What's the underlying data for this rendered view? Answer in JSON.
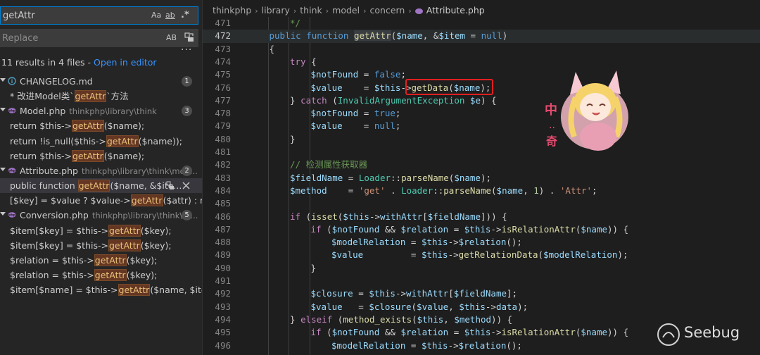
{
  "search": {
    "query": "getAttr",
    "replace_placeholder": "Replace",
    "opt_case": "Aa",
    "opt_word": "ab",
    "opt_regex": ".*",
    "opt_preserve_case": "AB",
    "more": "···",
    "summary": "11 results in 4 files - ",
    "open_in_editor": "Open in editor"
  },
  "results": [
    {
      "kind": "file",
      "name": "CHANGELOG.md",
      "path": "",
      "count": "1",
      "icon": "info-icon"
    },
    {
      "kind": "match",
      "pre": "* 改进Model类`",
      "hit": "getAttr",
      "post": "`方法"
    },
    {
      "kind": "file",
      "name": "Model.php",
      "path": "thinkphp\\library\\think",
      "count": "3",
      "icon": "php-icon"
    },
    {
      "kind": "match",
      "pre": "return $this->",
      "hit": "getAttr",
      "post": "($name);"
    },
    {
      "kind": "match",
      "pre": "return !is_null($this->",
      "hit": "getAttr",
      "post": "($name));"
    },
    {
      "kind": "match",
      "pre": "return $this->",
      "hit": "getAttr",
      "post": "($name);"
    },
    {
      "kind": "file",
      "name": "Attribute.php",
      "path": "thinkphp\\library\\think\\mod...",
      "count": "2",
      "icon": "php-icon"
    },
    {
      "kind": "match",
      "pre": "public function ",
      "hit": "getAttr",
      "post": "($name, &$ite...",
      "selected": true
    },
    {
      "kind": "match",
      "pre": "[$key] = $value ? $value->",
      "hit": "getAttr",
      "post": "($attr) : null;"
    },
    {
      "kind": "file",
      "name": "Conversion.php",
      "path": "thinkphp\\library\\think\\m...",
      "count": "5",
      "icon": "php-icon"
    },
    {
      "kind": "match",
      "pre": "$item[$key] = $this->",
      "hit": "getAttr",
      "post": "($key);"
    },
    {
      "kind": "match",
      "pre": "$item[$key] = $this->",
      "hit": "getAttr",
      "post": "($key);"
    },
    {
      "kind": "match",
      "pre": "$relation = $this->",
      "hit": "getAttr",
      "post": "($key);"
    },
    {
      "kind": "match",
      "pre": "$relation = $this->",
      "hit": "getAttr",
      "post": "($key);"
    },
    {
      "kind": "match",
      "pre": "$item[$name] = $this->",
      "hit": "getAttr",
      "post": "($name, $item);"
    }
  ],
  "breadcrumb": [
    "thinkphp",
    "library",
    "think",
    "model",
    "concern",
    "Attribute.php"
  ],
  "code_lines": [
    {
      "n": "471",
      "indent": 2,
      "toks": [
        [
          "cmt",
          "*/"
        ]
      ]
    },
    {
      "n": "472",
      "indent": 1,
      "current": true,
      "toks": [
        [
          "kw",
          "public"
        ],
        [
          "pun",
          " "
        ],
        [
          "kw",
          "function"
        ],
        [
          "pun",
          " "
        ],
        [
          "fnhl",
          "getAttr"
        ],
        [
          "pun",
          "("
        ],
        [
          "var",
          "$name"
        ],
        [
          "pun",
          ", &"
        ],
        [
          "var",
          "$item"
        ],
        [
          "pun",
          " = "
        ],
        [
          "kw",
          "null"
        ],
        [
          "pun",
          ")"
        ]
      ]
    },
    {
      "n": "473",
      "indent": 1,
      "toks": [
        [
          "pun",
          "{"
        ]
      ]
    },
    {
      "n": "474",
      "indent": 2,
      "toks": [
        [
          "ctl",
          "try"
        ],
        [
          "pun",
          " {"
        ]
      ]
    },
    {
      "n": "475",
      "indent": 3,
      "toks": [
        [
          "var",
          "$notFound"
        ],
        [
          "pun",
          " = "
        ],
        [
          "kw",
          "false"
        ],
        [
          "pun",
          ";"
        ]
      ]
    },
    {
      "n": "476",
      "indent": 3,
      "toks": [
        [
          "var",
          "$value"
        ],
        [
          "pun",
          "    = "
        ],
        [
          "var",
          "$this"
        ],
        [
          "pun",
          "->"
        ],
        [
          "fn",
          "getData"
        ],
        [
          "pun",
          "("
        ],
        [
          "var",
          "$name"
        ],
        [
          "pun",
          ");"
        ]
      ]
    },
    {
      "n": "477",
      "indent": 2,
      "toks": [
        [
          "pun",
          "} "
        ],
        [
          "ctl",
          "catch"
        ],
        [
          "pun",
          " ("
        ],
        [
          "cls",
          "InvalidArgumentException"
        ],
        [
          "pun",
          " "
        ],
        [
          "var",
          "$e"
        ],
        [
          "pun",
          ") {"
        ]
      ]
    },
    {
      "n": "478",
      "indent": 3,
      "toks": [
        [
          "var",
          "$notFound"
        ],
        [
          "pun",
          " = "
        ],
        [
          "kw",
          "true"
        ],
        [
          "pun",
          ";"
        ]
      ]
    },
    {
      "n": "479",
      "indent": 3,
      "toks": [
        [
          "var",
          "$value"
        ],
        [
          "pun",
          "    = "
        ],
        [
          "kw",
          "null"
        ],
        [
          "pun",
          ";"
        ]
      ]
    },
    {
      "n": "480",
      "indent": 2,
      "toks": [
        [
          "pun",
          "}"
        ]
      ]
    },
    {
      "n": "481",
      "indent": 0,
      "toks": []
    },
    {
      "n": "482",
      "indent": 2,
      "toks": [
        [
          "cmt",
          "// 检测属性获取器"
        ]
      ]
    },
    {
      "n": "483",
      "indent": 2,
      "toks": [
        [
          "var",
          "$fieldName"
        ],
        [
          "pun",
          " = "
        ],
        [
          "cls",
          "Loader"
        ],
        [
          "pun",
          "::"
        ],
        [
          "fn",
          "parseName"
        ],
        [
          "pun",
          "("
        ],
        [
          "var",
          "$name"
        ],
        [
          "pun",
          ");"
        ]
      ]
    },
    {
      "n": "484",
      "indent": 2,
      "toks": [
        [
          "var",
          "$method"
        ],
        [
          "pun",
          "    = "
        ],
        [
          "str",
          "'get'"
        ],
        [
          "pun",
          " . "
        ],
        [
          "cls",
          "Loader"
        ],
        [
          "pun",
          "::"
        ],
        [
          "fn",
          "parseName"
        ],
        [
          "pun",
          "("
        ],
        [
          "var",
          "$name"
        ],
        [
          "pun",
          ", "
        ],
        [
          "num",
          "1"
        ],
        [
          "pun",
          ") . "
        ],
        [
          "str",
          "'Attr'"
        ],
        [
          "pun",
          ";"
        ]
      ]
    },
    {
      "n": "485",
      "indent": 0,
      "toks": []
    },
    {
      "n": "486",
      "indent": 2,
      "toks": [
        [
          "ctl",
          "if"
        ],
        [
          "pun",
          " ("
        ],
        [
          "fn",
          "isset"
        ],
        [
          "pun",
          "("
        ],
        [
          "var",
          "$this"
        ],
        [
          "pun",
          "->"
        ],
        [
          "var",
          "withAttr"
        ],
        [
          "pun",
          "["
        ],
        [
          "var",
          "$fieldName"
        ],
        [
          "pun",
          "])) {"
        ]
      ]
    },
    {
      "n": "487",
      "indent": 3,
      "toks": [
        [
          "ctl",
          "if"
        ],
        [
          "pun",
          " ("
        ],
        [
          "var",
          "$notFound"
        ],
        [
          "pun",
          " && "
        ],
        [
          "var",
          "$relation"
        ],
        [
          "pun",
          " = "
        ],
        [
          "var",
          "$this"
        ],
        [
          "pun",
          "->"
        ],
        [
          "fn",
          "isRelationAttr"
        ],
        [
          "pun",
          "("
        ],
        [
          "var",
          "$name"
        ],
        [
          "pun",
          ")) {"
        ]
      ]
    },
    {
      "n": "488",
      "indent": 4,
      "toks": [
        [
          "var",
          "$modelRelation"
        ],
        [
          "pun",
          " = "
        ],
        [
          "var",
          "$this"
        ],
        [
          "pun",
          "->"
        ],
        [
          "var",
          "$relation"
        ],
        [
          "pun",
          "();"
        ]
      ]
    },
    {
      "n": "489",
      "indent": 4,
      "toks": [
        [
          "var",
          "$value"
        ],
        [
          "pun",
          "         = "
        ],
        [
          "var",
          "$this"
        ],
        [
          "pun",
          "->"
        ],
        [
          "fn",
          "getRelationData"
        ],
        [
          "pun",
          "("
        ],
        [
          "var",
          "$modelRelation"
        ],
        [
          "pun",
          ");"
        ]
      ]
    },
    {
      "n": "490",
      "indent": 3,
      "toks": [
        [
          "pun",
          "}"
        ]
      ]
    },
    {
      "n": "491",
      "indent": 0,
      "toks": []
    },
    {
      "n": "492",
      "indent": 3,
      "toks": [
        [
          "var",
          "$closure"
        ],
        [
          "pun",
          " = "
        ],
        [
          "var",
          "$this"
        ],
        [
          "pun",
          "->"
        ],
        [
          "var",
          "withAttr"
        ],
        [
          "pun",
          "["
        ],
        [
          "var",
          "$fieldName"
        ],
        [
          "pun",
          "];"
        ]
      ]
    },
    {
      "n": "493",
      "indent": 3,
      "toks": [
        [
          "var",
          "$value"
        ],
        [
          "pun",
          "   = "
        ],
        [
          "var",
          "$closure"
        ],
        [
          "pun",
          "("
        ],
        [
          "var",
          "$value"
        ],
        [
          "pun",
          ", "
        ],
        [
          "var",
          "$this"
        ],
        [
          "pun",
          "->"
        ],
        [
          "var",
          "data"
        ],
        [
          "pun",
          ");"
        ]
      ]
    },
    {
      "n": "494",
      "indent": 2,
      "toks": [
        [
          "pun",
          "} "
        ],
        [
          "ctl",
          "elseif"
        ],
        [
          "pun",
          " ("
        ],
        [
          "fn",
          "method_exists"
        ],
        [
          "pun",
          "("
        ],
        [
          "var",
          "$this"
        ],
        [
          "pun",
          ", "
        ],
        [
          "var",
          "$method"
        ],
        [
          "pun",
          ")) {"
        ]
      ]
    },
    {
      "n": "495",
      "indent": 3,
      "toks": [
        [
          "ctl",
          "if"
        ],
        [
          "pun",
          " ("
        ],
        [
          "var",
          "$notFound"
        ],
        [
          "pun",
          " && "
        ],
        [
          "var",
          "$relation"
        ],
        [
          "pun",
          " = "
        ],
        [
          "var",
          "$this"
        ],
        [
          "pun",
          "->"
        ],
        [
          "fn",
          "isRelationAttr"
        ],
        [
          "pun",
          "("
        ],
        [
          "var",
          "$name"
        ],
        [
          "pun",
          ")) {"
        ]
      ]
    },
    {
      "n": "496",
      "indent": 4,
      "toks": [
        [
          "var",
          "$modelRelation"
        ],
        [
          "pun",
          " = "
        ],
        [
          "var",
          "$this"
        ],
        [
          "pun",
          "->"
        ],
        [
          "var",
          "$relation"
        ],
        [
          "pun",
          "();"
        ]
      ]
    }
  ],
  "watermark": "Seebug",
  "colors": {
    "accent": "#007fd4",
    "link": "#3794ff",
    "match_highlight": "#653723",
    "annotation_box": "#e02020"
  }
}
